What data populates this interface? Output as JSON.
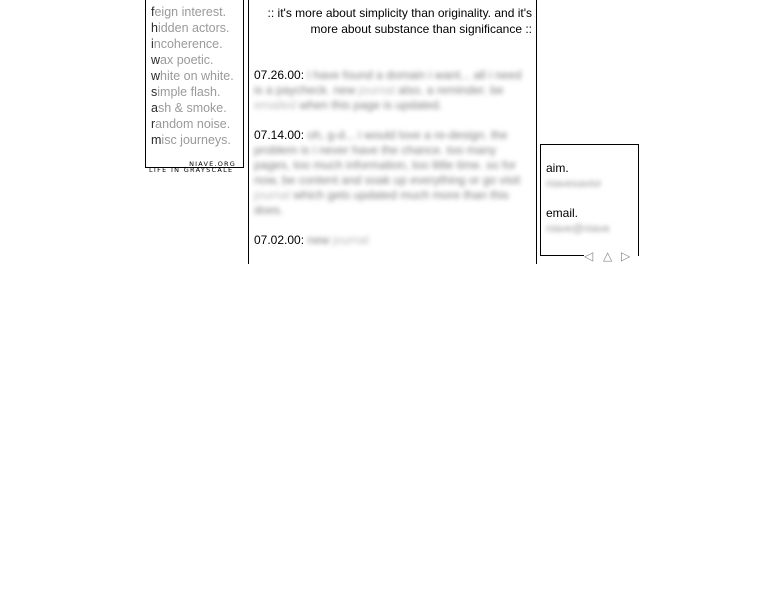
{
  "nav": {
    "items": [
      {
        "first": "f",
        "rest": "eign interest."
      },
      {
        "first": "h",
        "rest": "idden actors."
      },
      {
        "first": "i",
        "rest": "ncoherence."
      },
      {
        "first": "w",
        "rest": "ax poetic."
      },
      {
        "first": "w",
        "rest": "hite on white."
      },
      {
        "first": "s",
        "rest": "imple flash."
      },
      {
        "first": "a",
        "rest": "sh & smoke."
      },
      {
        "first": "r",
        "rest": "andom noise."
      },
      {
        "first": "m",
        "rest": "isc journeys."
      }
    ],
    "site": "NIAVE.ORG",
    "tagline": "LIFE IN GRAYSCALE"
  },
  "motto": ":: it's more about simplicity than originality. and it's more about substance than significance ::",
  "entries": [
    {
      "date": "07.26.00:",
      "text": "i have found a domain i want... all i need is a paycheck. new",
      "link": "journal",
      "text2": "also. a reminder. be",
      "link2": "emailed",
      "text3": "when this page is updated."
    },
    {
      "date": "07.14.00:",
      "text": "oh, g-d... i would love a re-design. the problem is i never have the chance. too many pages, too much information, too little time. so for now, be content and soak up everything or go visit",
      "link": "journal",
      "text2": "which gets updated much more than this does.",
      "link2": "",
      "text3": ""
    },
    {
      "date": "07.02.00:",
      "text": "new",
      "link": "journal",
      "text2": "",
      "link2": "",
      "text3": ""
    }
  ],
  "contact": {
    "aim_label": "aim.",
    "aim_value": "niavesavior",
    "email_label": "email.",
    "email_value": "niave@niave"
  },
  "arrows": {
    "prev": "◁",
    "top": "△",
    "next": "▷"
  }
}
